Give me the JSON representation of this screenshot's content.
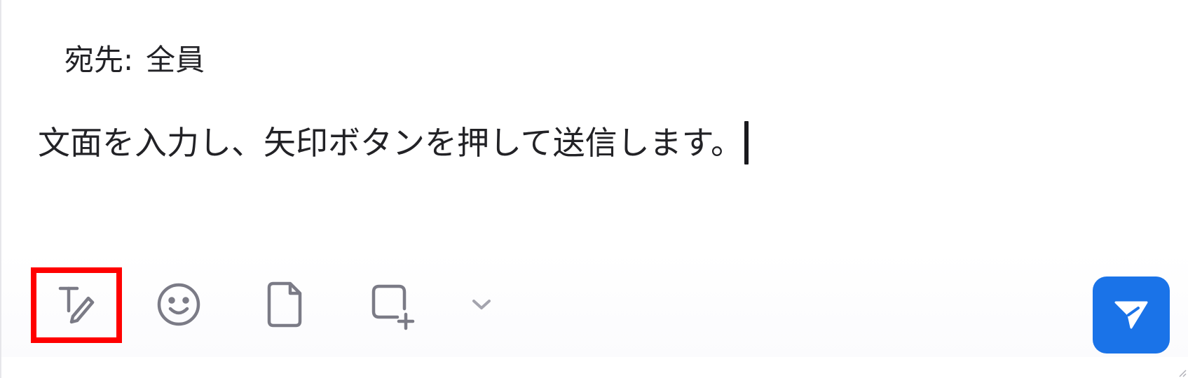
{
  "recipient": {
    "label": "宛先:",
    "value": "全員"
  },
  "message": {
    "text": "文面を入力し、矢印ボタンを押して送信します。"
  },
  "toolbar": {
    "icons": {
      "format": "text-format-icon",
      "emoji": "emoji-icon",
      "file": "file-icon",
      "screenshot": "screenshot-icon",
      "dropdown": "chevron-down-icon",
      "send": "send-arrow-icon"
    },
    "colors": {
      "icon": "#7b7b86",
      "send_bg": "#1a73e8",
      "highlight": "#ff0000"
    }
  }
}
